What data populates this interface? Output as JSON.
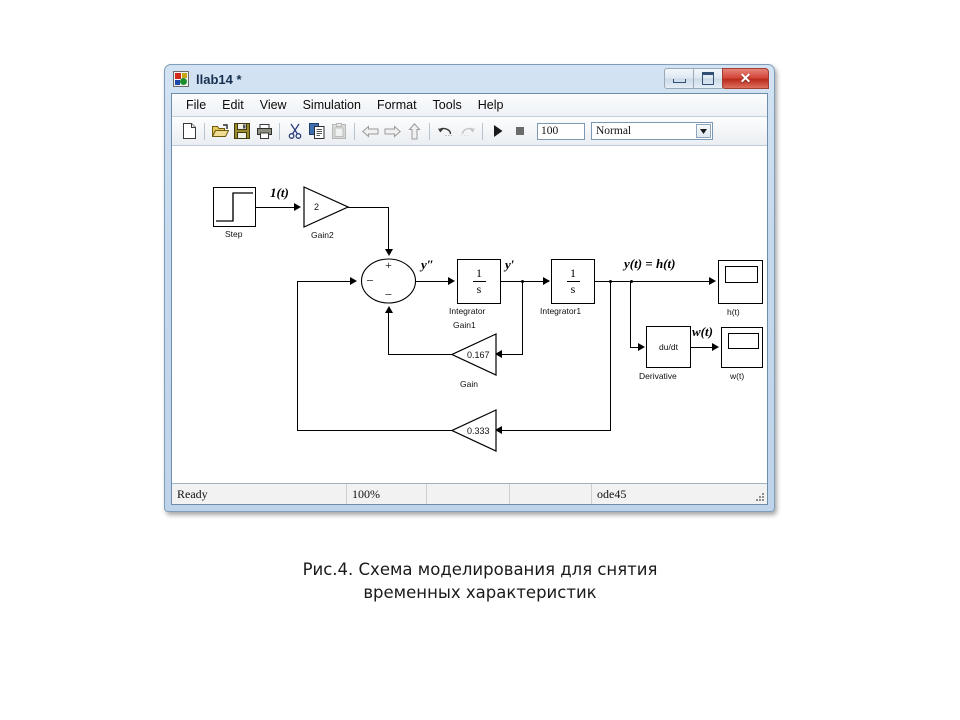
{
  "window": {
    "title": "llab14 *",
    "icon": "simulink-icon",
    "buttons": {
      "minimize": "minimize-button",
      "maximize": "maximize-button",
      "close_glyph": "✕"
    }
  },
  "menu": {
    "items": [
      "File",
      "Edit",
      "View",
      "Simulation",
      "Format",
      "Tools",
      "Help"
    ]
  },
  "toolbar": {
    "buttons": [
      {
        "name": "new-model-icon",
        "enabled": true
      },
      {
        "name": "open-model-icon",
        "enabled": true
      },
      {
        "name": "save-icon",
        "enabled": true
      },
      {
        "name": "print-icon",
        "enabled": true
      },
      {
        "name": "cut-icon",
        "enabled": true
      },
      {
        "name": "copy-icon",
        "enabled": true
      },
      {
        "name": "paste-icon",
        "enabled": false
      },
      {
        "name": "back-icon",
        "enabled": false
      },
      {
        "name": "forward-icon",
        "enabled": false
      },
      {
        "name": "up-level-icon",
        "enabled": false
      },
      {
        "name": "undo-icon",
        "enabled": true
      },
      {
        "name": "redo-icon",
        "enabled": false
      },
      {
        "name": "start-simulation-icon",
        "enabled": true
      },
      {
        "name": "stop-simulation-icon",
        "enabled": false
      }
    ],
    "sim_time": "100",
    "sim_mode": "Normal"
  },
  "status_bar": {
    "ready": "Ready",
    "zoom": "100%",
    "pane3": "",
    "pane4": "",
    "solver": "ode45"
  },
  "diagram": {
    "blocks": {
      "step": {
        "label": "Step",
        "type": "step-block"
      },
      "gain2": {
        "label": "Gain2",
        "value": "2",
        "type": "gain-block"
      },
      "sum": {
        "label": "",
        "signs": [
          "+",
          "−",
          "−"
        ],
        "type": "sum-block"
      },
      "integrator": {
        "label": "Integrator",
        "num": "1",
        "den": "s",
        "type": "integrator-block"
      },
      "integrator1": {
        "label": "Integrator1",
        "num": "1",
        "den": "s",
        "type": "integrator-block"
      },
      "gain1_label": {
        "label": "Gain1"
      },
      "gain_inner": {
        "label": "Gain",
        "value": "0.167",
        "type": "gain-block"
      },
      "gain_outer": {
        "label": "",
        "value": "0.333",
        "type": "gain-block"
      },
      "derivative": {
        "label": "Derivative",
        "value": "du/dt",
        "type": "derivative-block"
      },
      "scope_h": {
        "label": "h(t)",
        "type": "scope-block"
      },
      "scope_w": {
        "label": "w(t)",
        "type": "scope-block"
      }
    },
    "signal_labels": {
      "input": "1(t)",
      "y2": "y″",
      "y1": "y′",
      "y": "y(t) = h(t)",
      "w": "w(t)"
    }
  },
  "caption": {
    "line1": "Рис.4. Схема моделирования для снятия",
    "line2": "временных характеристик"
  },
  "colors": {
    "title_bar": "#c5d9ee",
    "close_button": "#d4483a",
    "canvas": "#ffffff",
    "line": "#000000"
  }
}
